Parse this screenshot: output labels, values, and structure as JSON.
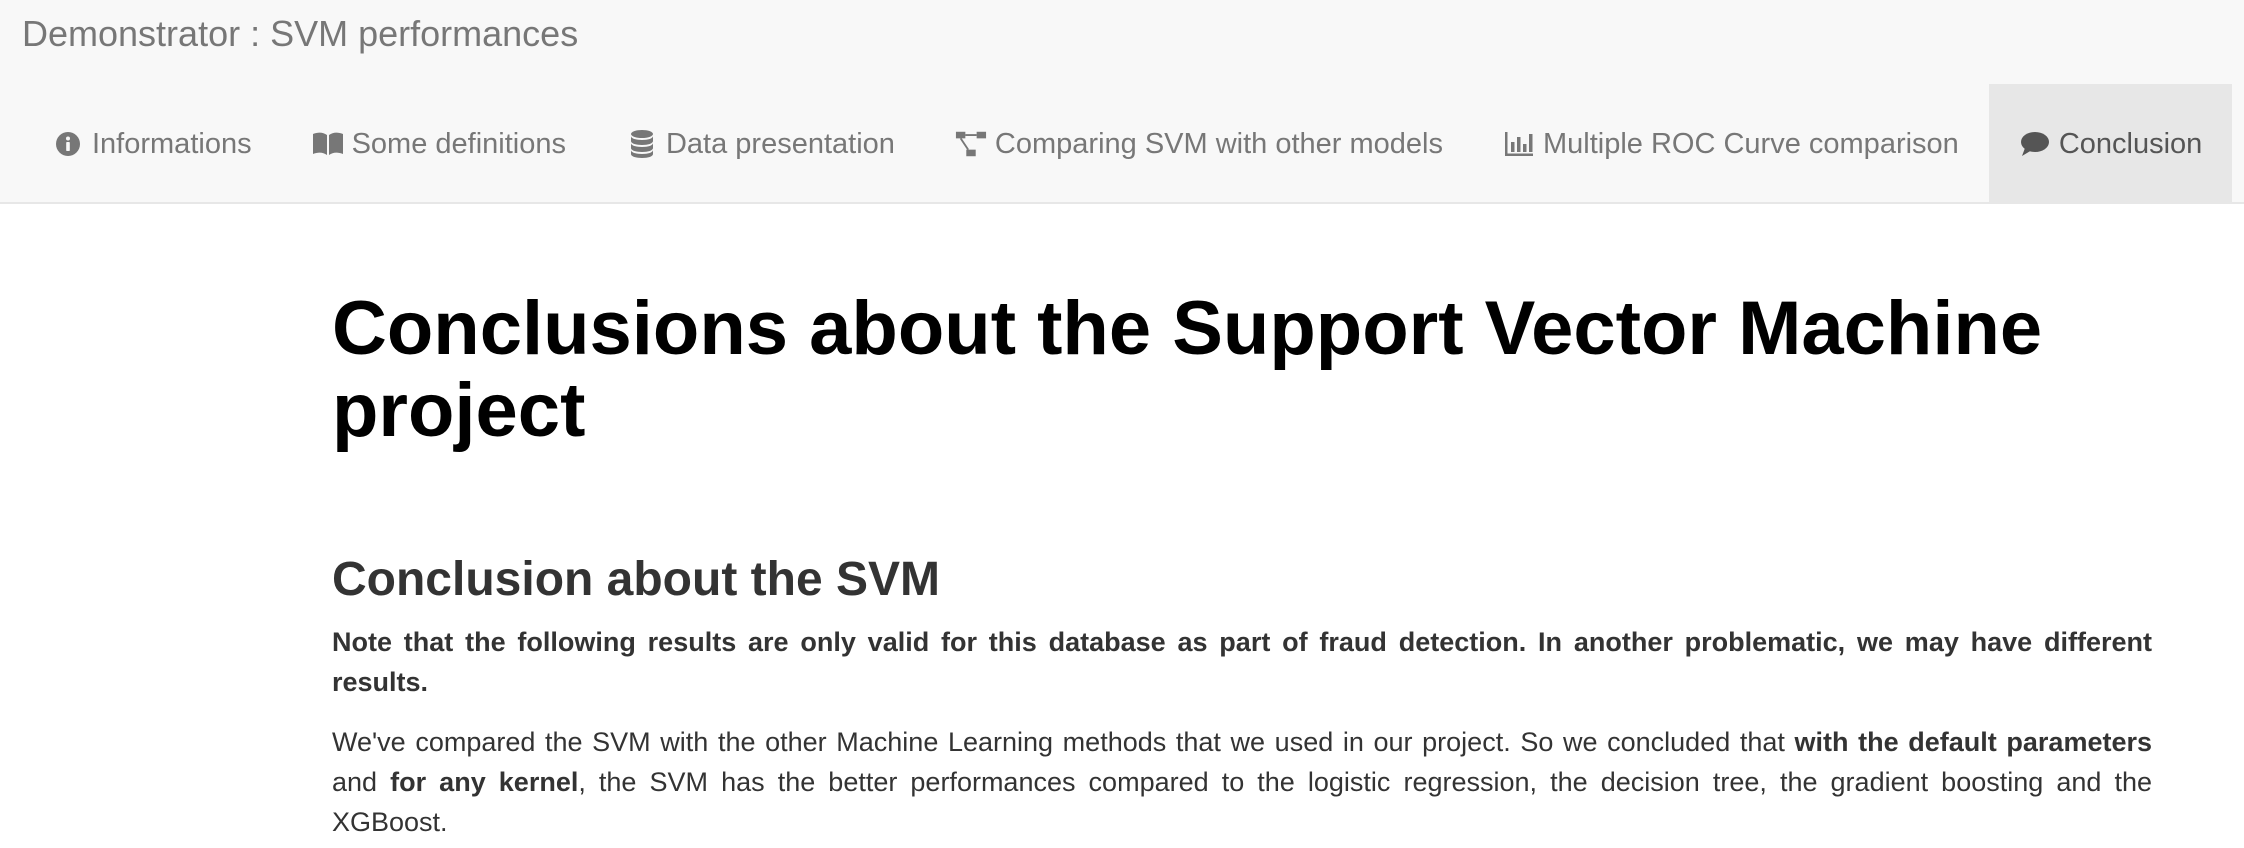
{
  "navbar": {
    "brand": "Demonstrator : SVM performances",
    "tabs": [
      {
        "label": "Informations",
        "icon": "info-circle-icon",
        "active": false
      },
      {
        "label": "Some definitions",
        "icon": "book-open-icon",
        "active": false
      },
      {
        "label": "Data presentation",
        "icon": "database-icon",
        "active": false
      },
      {
        "label": "Comparing SVM with other models",
        "icon": "sitemap-icon",
        "active": false
      },
      {
        "label": "Multiple ROC Curve comparison",
        "icon": "bar-chart-icon",
        "active": false
      },
      {
        "label": "Conclusion",
        "icon": "comment-icon",
        "active": true
      }
    ]
  },
  "main": {
    "title": "Conclusions about the Support Vector Machine project",
    "section_title": "Conclusion about the SVM",
    "note": "Note that the following results are only valid for this database as part of fraud detection. In another problematic, we may have different results.",
    "paragraph": {
      "part1": "We've compared the SVM with the other Machine Learning methods that we used in our project. So we concluded that ",
      "bold1": "with the default parameters",
      "part2": " and ",
      "bold2": "for any kernel",
      "part3": ", the SVM has the better performances compared to the logistic regression, the decision tree, the gradient boosting and the XGBoost."
    }
  },
  "colors": {
    "navbar_bg": "#f8f8f8",
    "active_tab_bg": "#e7e7e7",
    "nav_text": "#777777",
    "title_text": "#000000",
    "body_text": "#333333"
  }
}
